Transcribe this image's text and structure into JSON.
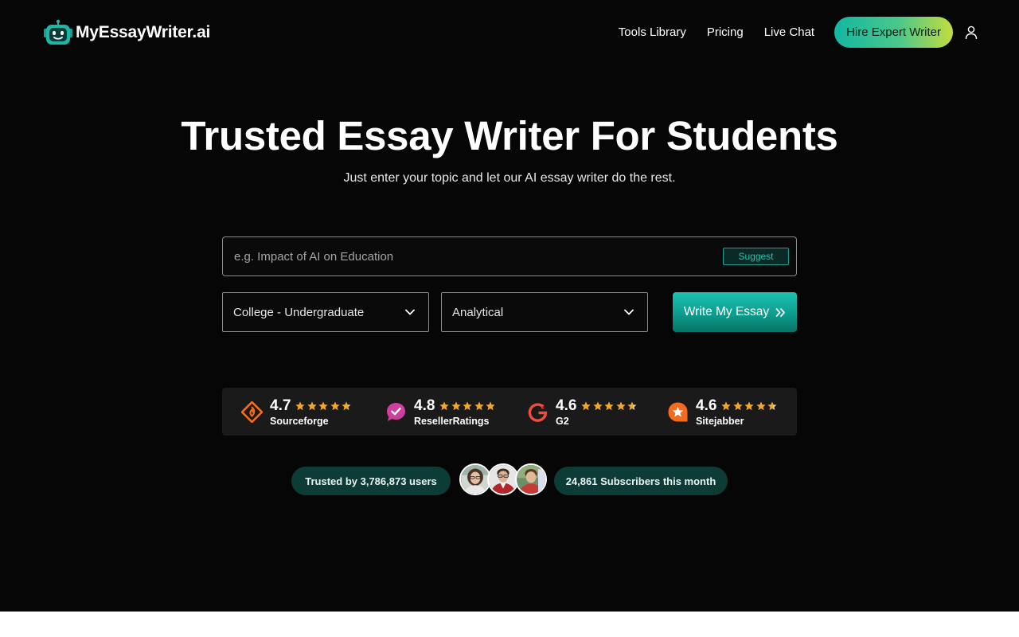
{
  "header": {
    "logo_text": "MyEssayWriter.ai",
    "nav": [
      {
        "label": "Tools Library"
      },
      {
        "label": "Pricing"
      },
      {
        "label": "Live Chat"
      }
    ],
    "cta_label": "Hire Expert Writer",
    "user_icon": "user-icon"
  },
  "hero": {
    "title": "Trusted Essay Writer For Students",
    "subtitle": "Just enter your topic and let our AI essay writer do the rest."
  },
  "form": {
    "topic_placeholder": "e.g. Impact of AI on Education",
    "topic_value": "",
    "suggest_label": "Suggest",
    "level_value": "College - Undergraduate",
    "type_value": "Analytical",
    "submit_label": "Write My Essay"
  },
  "ratings": [
    {
      "score": "4.7",
      "platform": "Sourceforge",
      "icon": "sourceforge-icon",
      "stars": 4.7
    },
    {
      "score": "4.8",
      "platform": "ResellerRatings",
      "icon": "resellerratings-icon",
      "stars": 4.8
    },
    {
      "score": "4.6",
      "platform": "G2",
      "icon": "g2-icon",
      "stars": 4.6
    },
    {
      "score": "4.6",
      "platform": "Sitejabber",
      "icon": "sitejabber-icon",
      "stars": 4.6
    }
  ],
  "trust": {
    "users_text": "Trusted by 3,786,873 users",
    "subscribers_text": "24,861 Subscribers this month"
  },
  "colors": {
    "background": "#060606",
    "accent": "#13b7a2",
    "star": "#f5a623",
    "pill": "#0d3b36"
  }
}
